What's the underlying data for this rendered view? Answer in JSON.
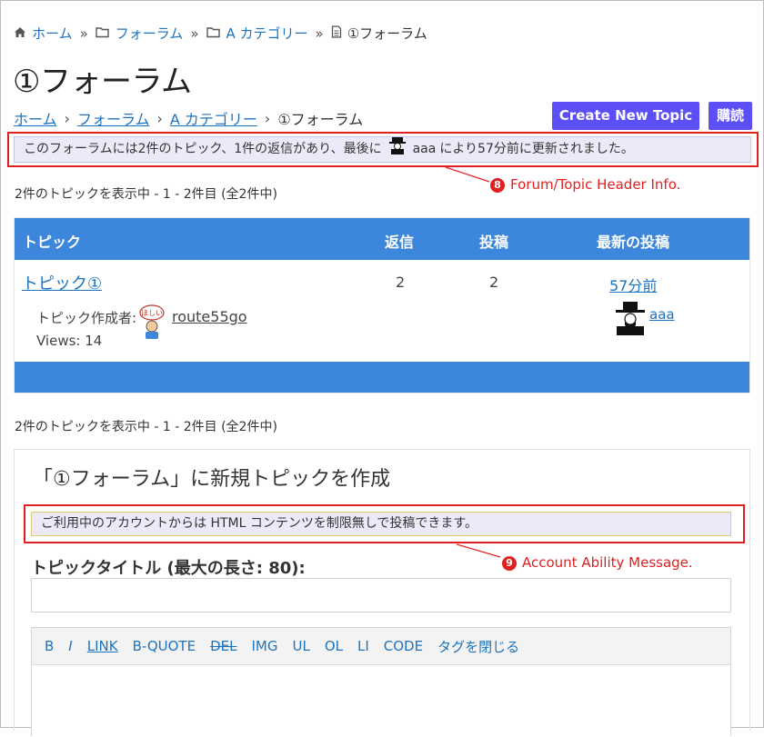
{
  "breadcrumb_top": {
    "home": "ホーム",
    "forums": "フォーラム",
    "category": "A カテゴリー",
    "current": "①フォーラム",
    "separator": "»"
  },
  "page_title": "①フォーラム",
  "breadcrumb_secondary": {
    "home": "ホーム",
    "forums": "フォーラム",
    "category": "A カテゴリー",
    "current": "①フォーラム",
    "separator": "›"
  },
  "buttons": {
    "create_new_topic": "Create New Topic",
    "subscribe": "購読"
  },
  "forum_info": {
    "prefix": "このフォーラムには2件のトピック、1件の返信があり、最後に",
    "user": "aaa",
    "suffix": "により57分前に更新されました。"
  },
  "annotations": {
    "forum_header": {
      "number": "8",
      "text": "Forum/Topic Header Info."
    },
    "account_message": {
      "number": "9",
      "text": "Account Ability Message."
    }
  },
  "count_text_top": "2件のトピックを表示中 - 1 - 2件目 (全2件中)",
  "count_text_bottom": "2件のトピックを表示中 - 1 - 2件目 (全2件中)",
  "table": {
    "headers": {
      "topic": "トピック",
      "replies": "返信",
      "posts": "投稿",
      "latest": "最新の投稿"
    },
    "rows": [
      {
        "title": "トピック①",
        "author_label": "トピック作成者:",
        "author": "route55go",
        "avatar_text": "ほしい",
        "views": "Views: 14",
        "replies": "2",
        "posts": "2",
        "latest_time": "57分前",
        "latest_user": "aaa"
      }
    ]
  },
  "new_topic": {
    "heading": "「①フォーラム」に新規トピックを作成",
    "account_message": "ご利用中のアカウントからは HTML コンテンツを制限無しで投稿できます。",
    "title_label": "トピックタイトル (最大の長さ: 80):",
    "title_value": "",
    "toolbar": [
      "B",
      "I",
      "LINK",
      "B-QUOTE",
      "DEL",
      "IMG",
      "UL",
      "OL",
      "LI",
      "CODE",
      "タグを閉じる"
    ]
  },
  "colors": {
    "link": "#1e73be",
    "button": "#5b4ff5",
    "table_header": "#3c86dc",
    "notice_bg": "#eceaf9",
    "annotation": "#e02020"
  }
}
